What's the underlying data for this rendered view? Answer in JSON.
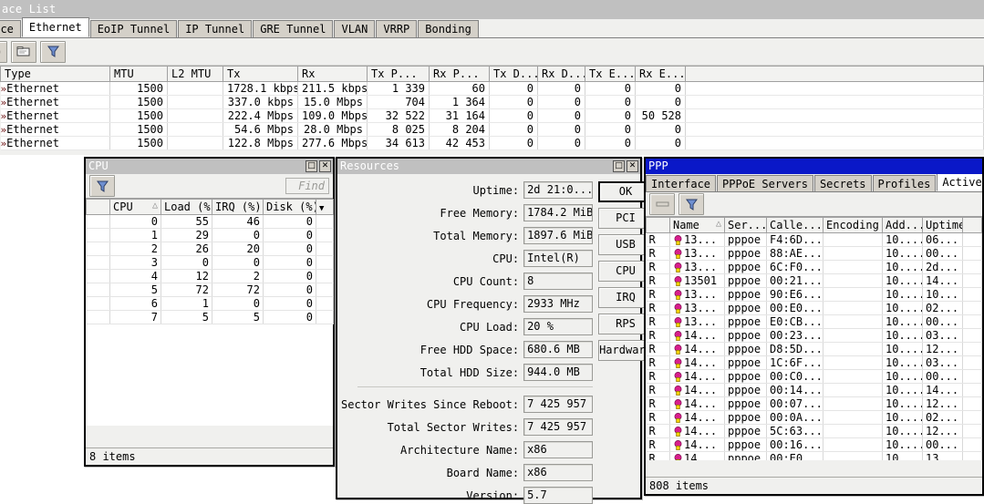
{
  "main_window": {
    "title": "ace List",
    "tabs": [
      {
        "label": "face",
        "active": false,
        "clipped": true
      },
      {
        "label": "Ethernet",
        "active": true,
        "clipped": false
      },
      {
        "label": "EoIP Tunnel",
        "active": false,
        "clipped": false
      },
      {
        "label": "IP Tunnel",
        "active": false,
        "clipped": false
      },
      {
        "label": "GRE Tunnel",
        "active": false,
        "clipped": false
      },
      {
        "label": "VLAN",
        "active": false,
        "clipped": false
      },
      {
        "label": "VRRP",
        "active": false,
        "clipped": false
      },
      {
        "label": "Bonding",
        "active": false,
        "clipped": false
      }
    ],
    "toolbar": {
      "buttons": [
        {
          "name": "disable-button",
          "icon": "circle-slash-icon"
        },
        {
          "name": "comment-button",
          "icon": "comment-box-icon"
        },
        {
          "name": "filter-button",
          "icon": "funnel-icon"
        }
      ]
    },
    "table": {
      "columns": [
        "Type",
        "MTU",
        "L2 MTU",
        "Tx",
        "Rx",
        "Tx P...",
        "Rx P...",
        "Tx D...",
        "Rx D...",
        "Tx E...",
        "Rx E..."
      ],
      "rows": [
        {
          "mark": "»",
          "Type": "Ethernet",
          "MTU": "1500",
          "L2 MTU": "",
          "Tx": "1728.1 kbps",
          "Rx": "211.5 kbps",
          "TxP": "1 339",
          "RxP": "60",
          "TxD": "0",
          "RxD": "0",
          "TxE": "0",
          "RxE": "0"
        },
        {
          "mark": "»",
          "Type": "Ethernet",
          "MTU": "1500",
          "L2 MTU": "",
          "Tx": "337.0 kbps",
          "Rx": "15.0 Mbps",
          "TxP": "704",
          "RxP": "1 364",
          "TxD": "0",
          "RxD": "0",
          "TxE": "0",
          "RxE": "0"
        },
        {
          "mark": "»",
          "Type": "Ethernet",
          "MTU": "1500",
          "L2 MTU": "",
          "Tx": "222.4 Mbps",
          "Rx": "109.0 Mbps",
          "TxP": "32 522",
          "RxP": "31 164",
          "TxD": "0",
          "RxD": "0",
          "TxE": "0",
          "RxE": "50 528"
        },
        {
          "mark": "»",
          "Type": "Ethernet",
          "MTU": "1500",
          "L2 MTU": "",
          "Tx": "54.6 Mbps",
          "Rx": "28.0 Mbps",
          "TxP": "8 025",
          "RxP": "8 204",
          "TxD": "0",
          "RxD": "0",
          "TxE": "0",
          "RxE": "0"
        },
        {
          "mark": "»",
          "Type": "Ethernet",
          "MTU": "1500",
          "L2 MTU": "",
          "Tx": "122.8 Mbps",
          "Rx": "277.6 Mbps",
          "TxP": "34 613",
          "RxP": "42 453",
          "TxD": "0",
          "RxD": "0",
          "TxE": "0",
          "RxE": "0"
        }
      ]
    }
  },
  "cpu_window": {
    "title": "CPU",
    "maximize_label": "□",
    "close_label": "✕",
    "find_placeholder": "Find",
    "filter_icon": "funnel-icon",
    "columns": [
      "",
      "CPU",
      "Load (%)",
      "IRQ (%)",
      "Disk (%)"
    ],
    "sort_column": "CPU",
    "rows": [
      {
        "cpu": "0",
        "load": "55",
        "irq": "46",
        "disk": "0"
      },
      {
        "cpu": "1",
        "load": "29",
        "irq": "0",
        "disk": "0"
      },
      {
        "cpu": "2",
        "load": "26",
        "irq": "20",
        "disk": "0"
      },
      {
        "cpu": "3",
        "load": "0",
        "irq": "0",
        "disk": "0"
      },
      {
        "cpu": "4",
        "load": "12",
        "irq": "2",
        "disk": "0"
      },
      {
        "cpu": "5",
        "load": "72",
        "irq": "72",
        "disk": "0"
      },
      {
        "cpu": "6",
        "load": "1",
        "irq": "0",
        "disk": "0"
      },
      {
        "cpu": "7",
        "load": "5",
        "irq": "5",
        "disk": "0"
      }
    ],
    "status": "8 items"
  },
  "resources_window": {
    "title": "Resources",
    "maximize_label": "□",
    "close_label": "✕",
    "fields_top": [
      {
        "label": "Uptime:",
        "value": "2d 21:0..."
      },
      {
        "label": "Free Memory:",
        "value": "1784.2 MiB"
      },
      {
        "label": "Total Memory:",
        "value": "1897.6 MiB"
      },
      {
        "label": "CPU:",
        "value": "Intel(R)"
      },
      {
        "label": "CPU Count:",
        "value": "8"
      },
      {
        "label": "CPU Frequency:",
        "value": "2933 MHz"
      },
      {
        "label": "CPU Load:",
        "value": "20 %"
      },
      {
        "label": "Free HDD Space:",
        "value": "680.6 MB"
      },
      {
        "label": "Total HDD Size:",
        "value": "944.0 MB"
      }
    ],
    "fields_bottom": [
      {
        "label": "Sector Writes Since Reboot:",
        "value": "7 425 957"
      },
      {
        "label": "Total Sector Writes:",
        "value": "7 425 957"
      },
      {
        "label": "Architecture Name:",
        "value": "x86"
      },
      {
        "label": "Board Name:",
        "value": "x86"
      },
      {
        "label": "Version:",
        "value": "5.7"
      }
    ],
    "buttons": [
      {
        "label": "OK",
        "default": true
      },
      {
        "label": "PCI",
        "default": false
      },
      {
        "label": "USB",
        "default": false
      },
      {
        "label": "CPU",
        "default": false
      },
      {
        "label": "IRQ",
        "default": false
      },
      {
        "label": "RPS",
        "default": false
      },
      {
        "label": "Hardware",
        "default": false
      }
    ]
  },
  "ppp_window": {
    "title": "PPP",
    "tabs": [
      {
        "label": "Interface",
        "active": false
      },
      {
        "label": "PPPoE Servers",
        "active": false
      },
      {
        "label": "Secrets",
        "active": false
      },
      {
        "label": "Profiles",
        "active": false
      },
      {
        "label": "Active Connecti",
        "active": true
      }
    ],
    "toolbar": {
      "buttons": [
        {
          "name": "remove-button",
          "icon": "minus-icon"
        },
        {
          "name": "filter-button",
          "icon": "funnel-icon"
        }
      ]
    },
    "columns": [
      "",
      "Name",
      "Ser...",
      "Calle...",
      "Encoding",
      "Add...",
      "Uptime"
    ],
    "sort_column": "Name",
    "rows": [
      {
        "flag": "R",
        "name": "13...",
        "service": "pppoe",
        "caller": "F4:6D...",
        "encoding": "",
        "address": "10....",
        "uptime": "06..."
      },
      {
        "flag": "R",
        "name": "13...",
        "service": "pppoe",
        "caller": "88:AE...",
        "encoding": "",
        "address": "10....",
        "uptime": "00..."
      },
      {
        "flag": "R",
        "name": "13...",
        "service": "pppoe",
        "caller": "6C:F0...",
        "encoding": "",
        "address": "10....",
        "uptime": "2d..."
      },
      {
        "flag": "R",
        "name": "13501",
        "service": "pppoe",
        "caller": "00:21...",
        "encoding": "",
        "address": "10....",
        "uptime": "14..."
      },
      {
        "flag": "R",
        "name": "13...",
        "service": "pppoe",
        "caller": "90:E6...",
        "encoding": "",
        "address": "10....",
        "uptime": "10..."
      },
      {
        "flag": "R",
        "name": "13...",
        "service": "pppoe",
        "caller": "00:E0...",
        "encoding": "",
        "address": "10....",
        "uptime": "02..."
      },
      {
        "flag": "R",
        "name": "13...",
        "service": "pppoe",
        "caller": "E0:CB...",
        "encoding": "",
        "address": "10....",
        "uptime": "00..."
      },
      {
        "flag": "R",
        "name": "14...",
        "service": "pppoe",
        "caller": "00:23...",
        "encoding": "",
        "address": "10....",
        "uptime": "03..."
      },
      {
        "flag": "R",
        "name": "14...",
        "service": "pppoe",
        "caller": "D8:5D...",
        "encoding": "",
        "address": "10....",
        "uptime": "12..."
      },
      {
        "flag": "R",
        "name": "14...",
        "service": "pppoe",
        "caller": "1C:6F...",
        "encoding": "",
        "address": "10....",
        "uptime": "03..."
      },
      {
        "flag": "R",
        "name": "14...",
        "service": "pppoe",
        "caller": "00:C0...",
        "encoding": "",
        "address": "10....",
        "uptime": "00..."
      },
      {
        "flag": "R",
        "name": "14...",
        "service": "pppoe",
        "caller": "00:14...",
        "encoding": "",
        "address": "10....",
        "uptime": "14..."
      },
      {
        "flag": "R",
        "name": "14...",
        "service": "pppoe",
        "caller": "00:07...",
        "encoding": "",
        "address": "10....",
        "uptime": "12..."
      },
      {
        "flag": "R",
        "name": "14...",
        "service": "pppoe",
        "caller": "00:0A...",
        "encoding": "",
        "address": "10....",
        "uptime": "02..."
      },
      {
        "flag": "R",
        "name": "14...",
        "service": "pppoe",
        "caller": "5C:63...",
        "encoding": "",
        "address": "10....",
        "uptime": "12..."
      },
      {
        "flag": "R",
        "name": "14...",
        "service": "pppoe",
        "caller": "00:16...",
        "encoding": "",
        "address": "10....",
        "uptime": "00..."
      },
      {
        "flag": "R",
        "name": "14",
        "service": "pppoe",
        "caller": "00:E0",
        "encoding": "",
        "address": "10",
        "uptime": "13"
      }
    ],
    "status": "808 items"
  },
  "colors": {
    "titlebar_active": "#0a18c8",
    "titlebar_inactive": "#c0c0c0",
    "window_face": "#f0f0ee",
    "tab_face": "#d4d0c8",
    "user_icon": "#d81f8c",
    "row_marker": "#6b1010"
  }
}
